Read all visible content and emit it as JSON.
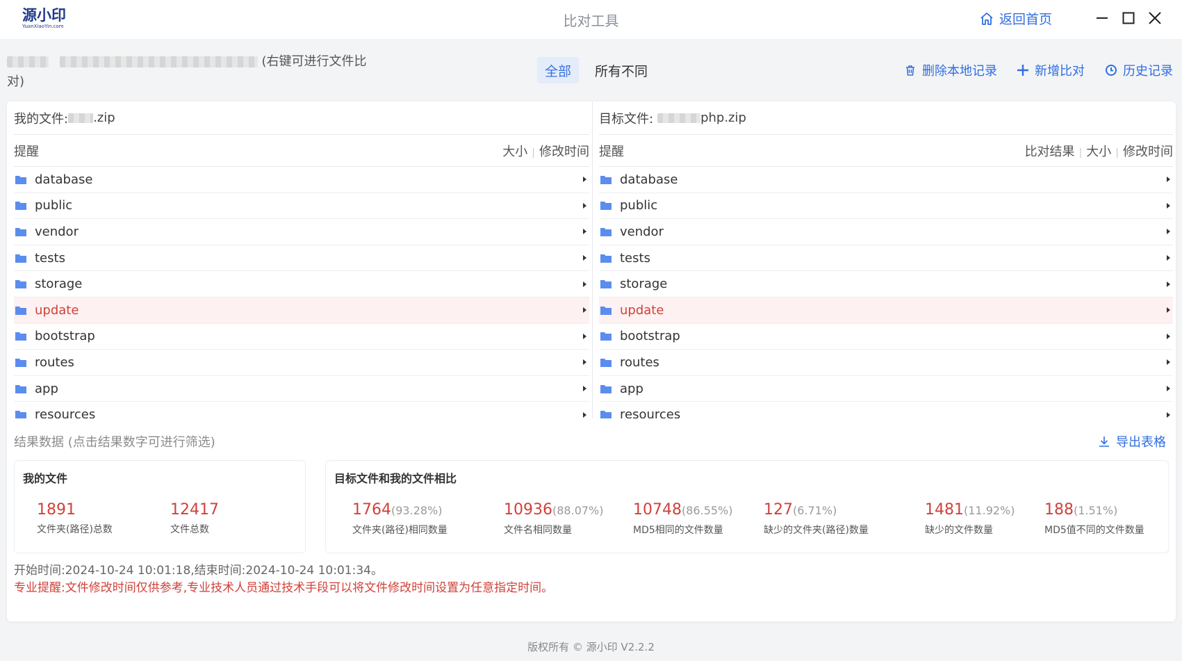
{
  "window": {
    "logo_cn": "源小印",
    "logo_en": "YuanXiaoYin.com",
    "title": "比对工具",
    "home_label": "返回首页"
  },
  "toolbar": {
    "hint": "(右键可进行文件比对)",
    "filter_all": "全部",
    "filter_diff": "所有不同",
    "delete_label": "删除本地记录",
    "add_label": "新增比对",
    "history_label": "历史记录"
  },
  "left_pane": {
    "file_label": "我的文件:",
    "file_name": ".zip",
    "list_title": "提醒",
    "col_size": "大小",
    "col_mtime": "修改时间",
    "items": [
      {
        "name": "database"
      },
      {
        "name": "public"
      },
      {
        "name": "vendor"
      },
      {
        "name": "tests"
      },
      {
        "name": "storage"
      },
      {
        "name": "update"
      },
      {
        "name": "bootstrap"
      },
      {
        "name": "routes"
      },
      {
        "name": "app"
      },
      {
        "name": "resources"
      }
    ]
  },
  "right_pane": {
    "file_label": "目标文件:",
    "file_name": "php.zip",
    "list_title": "提醒",
    "col_result": "比对结果",
    "col_size": "大小",
    "col_mtime": "修改时间",
    "items": [
      {
        "name": "database"
      },
      {
        "name": "public"
      },
      {
        "name": "vendor"
      },
      {
        "name": "tests"
      },
      {
        "name": "storage"
      },
      {
        "name": "update"
      },
      {
        "name": "bootstrap"
      },
      {
        "name": "routes"
      },
      {
        "name": "app"
      },
      {
        "name": "resources"
      }
    ]
  },
  "highlight_color": "#d0413a",
  "results": {
    "title": "结果数据 (点击结果数字可进行筛选)",
    "export_label": "导出表格",
    "my_files": {
      "title": "我的文件",
      "stats": [
        {
          "value": "1891",
          "label": "文件夹(路径)总数"
        },
        {
          "value": "12417",
          "label": "文件总数"
        }
      ]
    },
    "compare": {
      "title": "目标文件和我的文件相比",
      "stats": [
        {
          "value": "1764",
          "pct": "(93.28%)",
          "label": "文件夹(路径)相同数量"
        },
        {
          "value": "10936",
          "pct": "(88.07%)",
          "label": "文件名相同数量"
        },
        {
          "value": "10748",
          "pct": "(86.55%)",
          "label": "MD5相同的文件数量"
        },
        {
          "value": "127",
          "pct": "(6.71%)",
          "label": "缺少的文件夹(路径)数量"
        },
        {
          "value": "1481",
          "pct": "(11.92%)",
          "label": "缺少的文件数量"
        },
        {
          "value": "188",
          "pct": "(1.51%)",
          "label": "MD5值不同的文件数量"
        }
      ]
    },
    "time_line": "开始时间:2024-10-24 10:01:18,结束时间:2024-10-24 10:01:34。",
    "warning": "专业提醒:文件修改时间仅供参考,专业技术人员通过技术手段可以将文件修改时间设置为任意指定时间。"
  },
  "footer": "版权所有 © 源小印 V2.2.2"
}
